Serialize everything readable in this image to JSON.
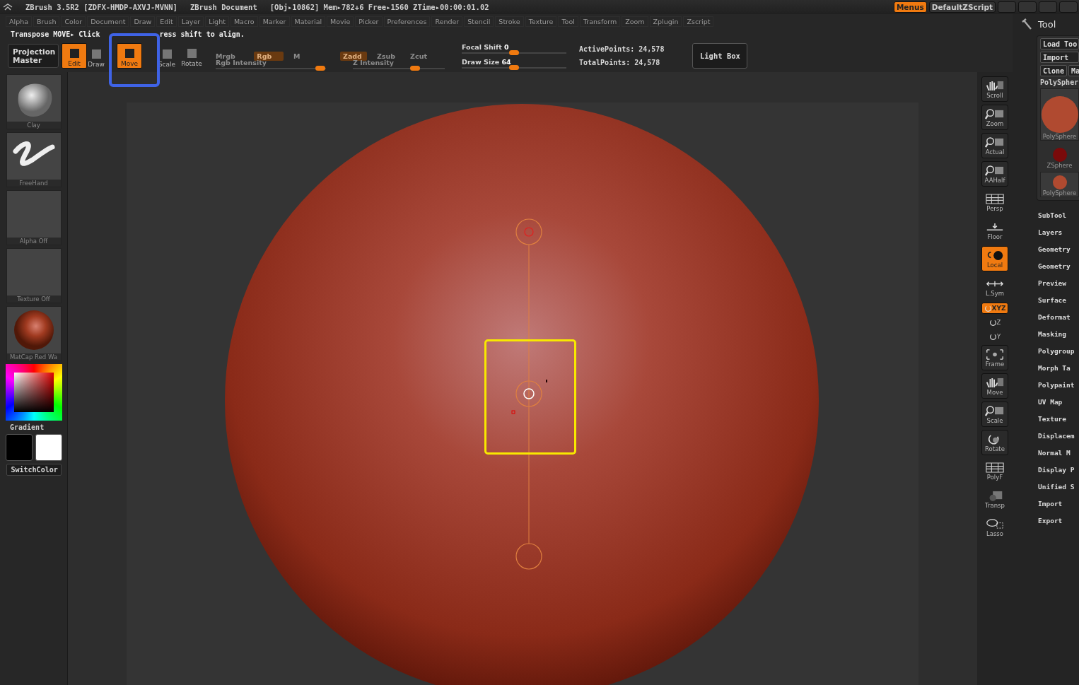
{
  "title_bar": {
    "title": "ZBrush 3.5R2 [ZDFX-HMDP-AXVJ-MVNN]",
    "document": "ZBrush Document",
    "stats": "[Obj▸10862] Mem▸782+6 Free▸1560 ZTime▸00:00:01.02",
    "buttons": [
      {
        "label": "Menus",
        "selected": true
      },
      {
        "label": "DefaultZScript",
        "selected": false
      }
    ]
  },
  "menu_bar": [
    "Alpha",
    "Brush",
    "Color",
    "Document",
    "Draw",
    "Edit",
    "Layer",
    "Light",
    "Macro",
    "Marker",
    "Material",
    "Movie",
    "Picker",
    "Preferences",
    "Render",
    "Stencil",
    "Stroke",
    "Texture",
    "Tool",
    "Transform",
    "Zoom",
    "Zplugin",
    "Zscript"
  ],
  "instruction": {
    "lead": "Transpose MOVE▸ Click",
    "tail": "ress shift to align."
  },
  "toolbar": {
    "projection_master": "Projection Master",
    "modes": [
      {
        "label": "Edit",
        "selected": true
      },
      {
        "label": "Draw",
        "selected": false
      },
      {
        "label": "Move",
        "selected": true
      },
      {
        "label": "Scale",
        "selected": false
      },
      {
        "label": "Rotate",
        "selected": false
      }
    ],
    "color_modes": [
      {
        "label": "Mrgb",
        "selected": false
      },
      {
        "label": "Rgb",
        "selected": true
      },
      {
        "label": "M",
        "selected": false
      }
    ],
    "depth_modes": [
      {
        "label": "Zadd",
        "selected": true
      },
      {
        "label": "Zsub",
        "selected": false
      },
      {
        "label": "Zcut",
        "selected": false
      }
    ],
    "rgb_intensity": {
      "label": "Rgb Intensity",
      "level": 0.95
    },
    "z_intensity": {
      "label": "Z Intensity",
      "level": 0.68
    },
    "focal_shift": {
      "label": "Focal Shift",
      "reading": "0",
      "level": 0.5
    },
    "draw_size": {
      "label": "Draw Size",
      "reading": "64",
      "level": 0.5
    },
    "active_points": "ActivePoints: 24,578",
    "total_points": "TotalPoints: 24,578",
    "light_box": "Light Box"
  },
  "left_shelf": {
    "items": [
      {
        "label": "Clay",
        "kind": "brush"
      },
      {
        "label": "FreeHand",
        "kind": "stroke"
      },
      {
        "label": "Alpha Off",
        "kind": "empty"
      },
      {
        "label": "Texture Off",
        "kind": "empty"
      },
      {
        "label": "MatCap Red Wa",
        "kind": "material"
      }
    ],
    "gradient": "Gradient",
    "swatches": [
      {
        "color": "#000000"
      },
      {
        "color": "#ffffff"
      }
    ],
    "switch_color": "SwitchColor"
  },
  "right_shelf": [
    {
      "label": "Scroll",
      "kind": "button",
      "selected": false
    },
    {
      "label": "Zoom",
      "kind": "button",
      "selected": false
    },
    {
      "label": "Actual",
      "kind": "button",
      "selected": false
    },
    {
      "label": "AAHalf",
      "kind": "button",
      "selected": false
    },
    {
      "label": "Persp",
      "kind": "flat",
      "selected": false
    },
    {
      "label": "Floor",
      "kind": "flat",
      "selected": false
    },
    {
      "label": "Local",
      "kind": "button",
      "selected": true
    },
    {
      "label": "L.Sym",
      "kind": "flat",
      "selected": false
    },
    {
      "label": "XYZ",
      "kind": "small",
      "selected": true
    },
    {
      "label": "Z",
      "kind": "mini",
      "selected": false
    },
    {
      "label": "Y",
      "kind": "mini",
      "selected": false
    },
    {
      "label": "Frame",
      "kind": "button",
      "selected": false
    },
    {
      "label": "Move",
      "kind": "button",
      "selected": false
    },
    {
      "label": "Scale",
      "kind": "button",
      "selected": false
    },
    {
      "label": "Rotate",
      "kind": "button",
      "selected": false
    },
    {
      "label": "PolyF",
      "kind": "flat",
      "selected": false
    },
    {
      "label": "Transp",
      "kind": "flat",
      "selected": false
    },
    {
      "label": "Lasso",
      "kind": "flat",
      "selected": false
    }
  ],
  "tool_panel": {
    "title": "Tool",
    "buttons": [
      "Load Too",
      "Import"
    ],
    "row": [
      "Clone",
      "Ma"
    ],
    "current": "PolySpher",
    "thumbnails": [
      {
        "label": "PolySphere",
        "kind": "large"
      },
      {
        "label": "ZSphere",
        "kind": "zsphere"
      },
      {
        "label": "PolySphere",
        "kind": "small"
      }
    ],
    "sections": [
      "SubTool",
      "Layers",
      "Geometry",
      "Geometry",
      "Preview",
      "Surface",
      "Deformat",
      "Masking",
      "Polygroup",
      "Morph Ta",
      "Polypaint",
      "UV Map",
      "Texture",
      "Displacem",
      "Normal M",
      "Display P",
      "Unified S",
      "Import",
      "Export"
    ]
  }
}
